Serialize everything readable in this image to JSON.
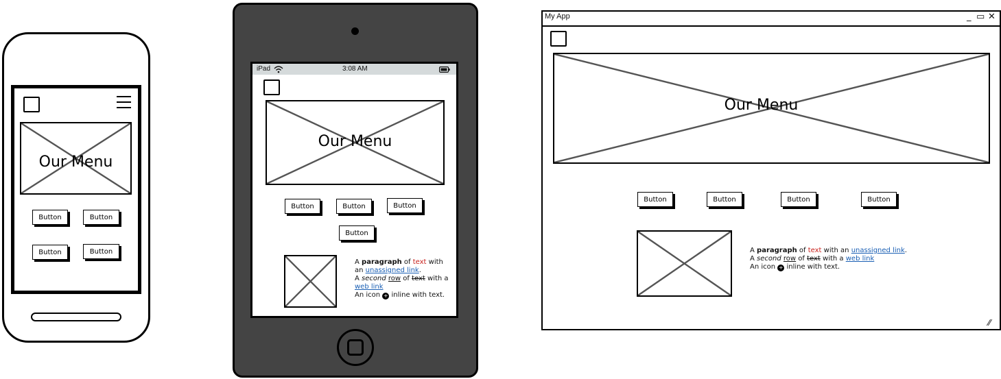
{
  "title_text": "Our Menu",
  "button_label": "Button",
  "paragraph": {
    "line1_a": "A ",
    "line1_bold": "paragraph",
    "line1_b": " of ",
    "line1_red": "text",
    "line1_c": " with an ",
    "line1_link": "unassigned link",
    "line1_end": ".",
    "line2_a": "A ",
    "line2_italic": "second",
    "line2_b": " ",
    "line2_underline": "row",
    "line2_c": " of ",
    "line2_strike": "text",
    "line2_d": " with a ",
    "line2_link": "web link",
    "line3_a": "An icon ",
    "line3_icon": "plus-circle-icon",
    "line3_b": " inline with text."
  },
  "colors": {
    "red_text": "#c8201b",
    "link": "#1a5fb4",
    "tablet_body": "#444444",
    "status_bar": "#d5dadb"
  },
  "tablet": {
    "carrier": "iPad",
    "time": "3:08 AM",
    "wifi_icon": "wifi-icon",
    "battery_icon": "battery-icon"
  },
  "window": {
    "title": "My App",
    "minimize_glyph": "_",
    "maximize_glyph": "▭",
    "close_glyph": "✕",
    "resize_glyph": "⁄⁄"
  }
}
